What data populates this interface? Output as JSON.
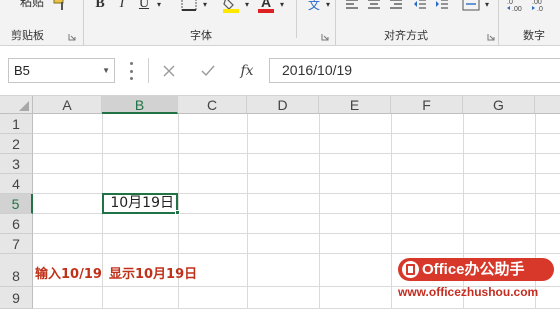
{
  "ribbon": {
    "groups": {
      "clipboard": "剪贴板",
      "font": "字体",
      "alignment": "对齐方式",
      "number": "数字"
    },
    "paste_label_fragment": "粘贴",
    "bold": "B",
    "italic": "I",
    "underline": "U",
    "font_color_glyph": "A",
    "phonetic_glyph": "文",
    "font_color_hex": "#e02020",
    "highlight_color_hex": "#ffe800"
  },
  "formula_bar": {
    "name_box": "B5",
    "fx": "fx",
    "value": "2016/10/19"
  },
  "grid": {
    "columns": [
      "A",
      "B",
      "C",
      "D",
      "E",
      "F",
      "G"
    ],
    "rows": [
      "1",
      "2",
      "3",
      "4",
      "5",
      "6",
      "7",
      "8",
      "9"
    ],
    "active_column": "B",
    "active_row": "5",
    "active_cell_value": "10月19日",
    "annotation": {
      "input_text": "输入10/19",
      "display_text": "显示10月19日"
    }
  },
  "watermark": {
    "badge_text": "Office办公助手",
    "url": "www.officezhushou.com"
  },
  "colors": {
    "accent": "#217346",
    "annotation": "#c0311a",
    "watermark": "#d8382a"
  }
}
